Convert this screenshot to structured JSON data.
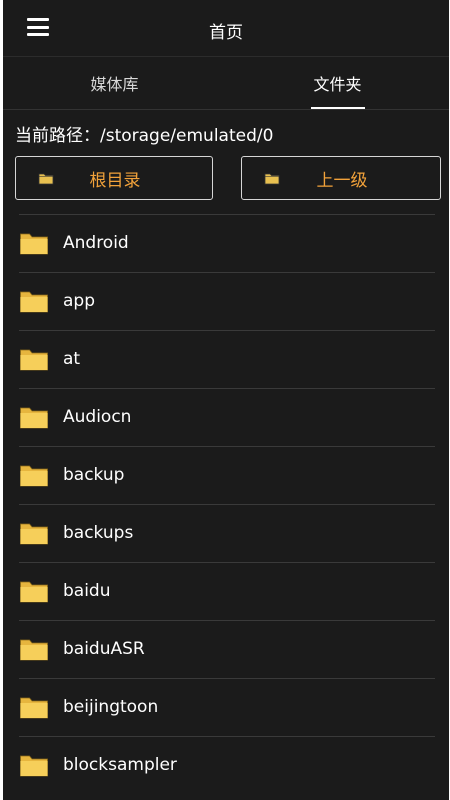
{
  "header": {
    "title": "首页"
  },
  "tabs": [
    {
      "label": "媒体库",
      "active": false
    },
    {
      "label": "文件夹",
      "active": true
    }
  ],
  "path": {
    "text": "当前路径：/storage/emulated/0"
  },
  "buttons": {
    "root_label": "根目录",
    "up_label": "上一级"
  },
  "folders": [
    "Android",
    "app",
    "at",
    "Audiocn",
    "backup",
    "backups",
    "baidu",
    "baiduASR",
    "beijingtoon",
    "blocksampler"
  ],
  "colors": {
    "background": "#1b1b1b",
    "accent": "#f2a23a",
    "folder": "#f6cf5a"
  },
  "icons": {
    "menu": "hamburger-menu-icon",
    "folder": "folder-icon"
  }
}
